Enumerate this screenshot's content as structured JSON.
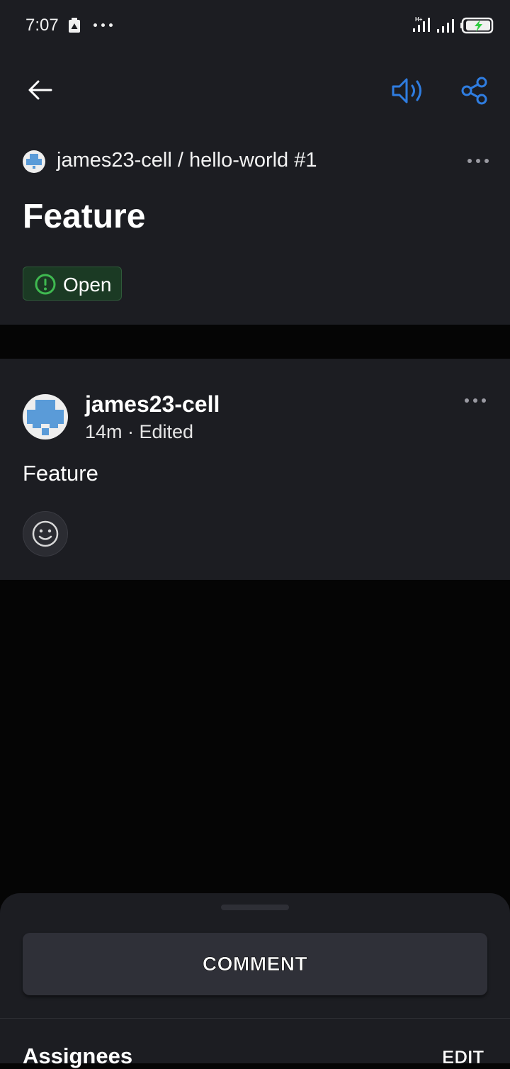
{
  "status_bar": {
    "time": "7:07",
    "icons": [
      "battery-saver-icon",
      "more-dots-icon",
      "signal-4g-icon",
      "signal-icon",
      "battery-charging-icon"
    ]
  },
  "toolbar": {
    "back_icon": "arrow-left-icon",
    "speak_icon": "speaker-icon",
    "share_icon": "share-icon",
    "accent_color": "#2f7de1"
  },
  "issue": {
    "repo_path": "james23-cell / hello-world #1",
    "title": "Feature",
    "status": "Open",
    "status_color": "#3fb950"
  },
  "comment": {
    "author": "james23-cell",
    "meta": "14m · Edited",
    "body": "Feature",
    "reaction_icon": "smiley-icon"
  },
  "sheet": {
    "comment_button": "COMMENT",
    "assignees_label": "Assignees",
    "edit_label": "EDIT"
  }
}
